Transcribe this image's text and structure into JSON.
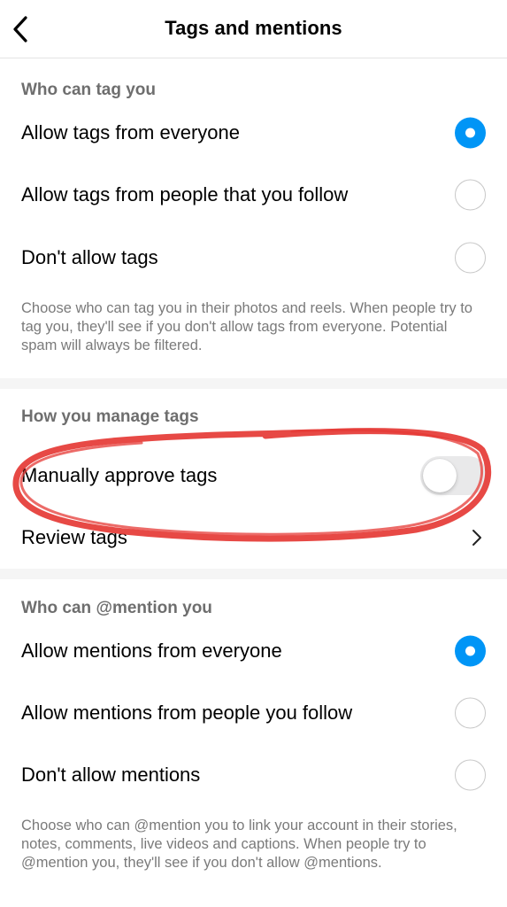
{
  "header": {
    "title": "Tags and mentions",
    "back_icon": "chevron-left-icon"
  },
  "tags": {
    "section_label": "Who can tag you",
    "options": [
      {
        "label": "Allow tags from everyone",
        "selected": true
      },
      {
        "label": "Allow tags from people that you follow",
        "selected": false
      },
      {
        "label": "Don't allow tags",
        "selected": false
      }
    ],
    "helper": "Choose who can tag you in their photos and reels. When people try to tag you, they'll see if you don't allow tags from everyone. Potential spam will always be filtered."
  },
  "manage": {
    "section_label": "How you manage tags",
    "manual_approve": {
      "label": "Manually approve tags",
      "enabled": false
    },
    "review": {
      "label": "Review tags",
      "icon": "chevron-right-icon"
    }
  },
  "mentions": {
    "section_label": "Who can @mention you",
    "options": [
      {
        "label": "Allow mentions from everyone",
        "selected": true
      },
      {
        "label": "Allow mentions from people you follow",
        "selected": false
      },
      {
        "label": "Don't allow mentions",
        "selected": false
      }
    ],
    "helper": "Choose who can @mention you to link your account in their stories, notes, comments, live videos and captions. When people try to @mention you, they'll see if you don't allow @mentions."
  },
  "colors": {
    "accent": "#0095f6",
    "annotation": "#e53935"
  }
}
